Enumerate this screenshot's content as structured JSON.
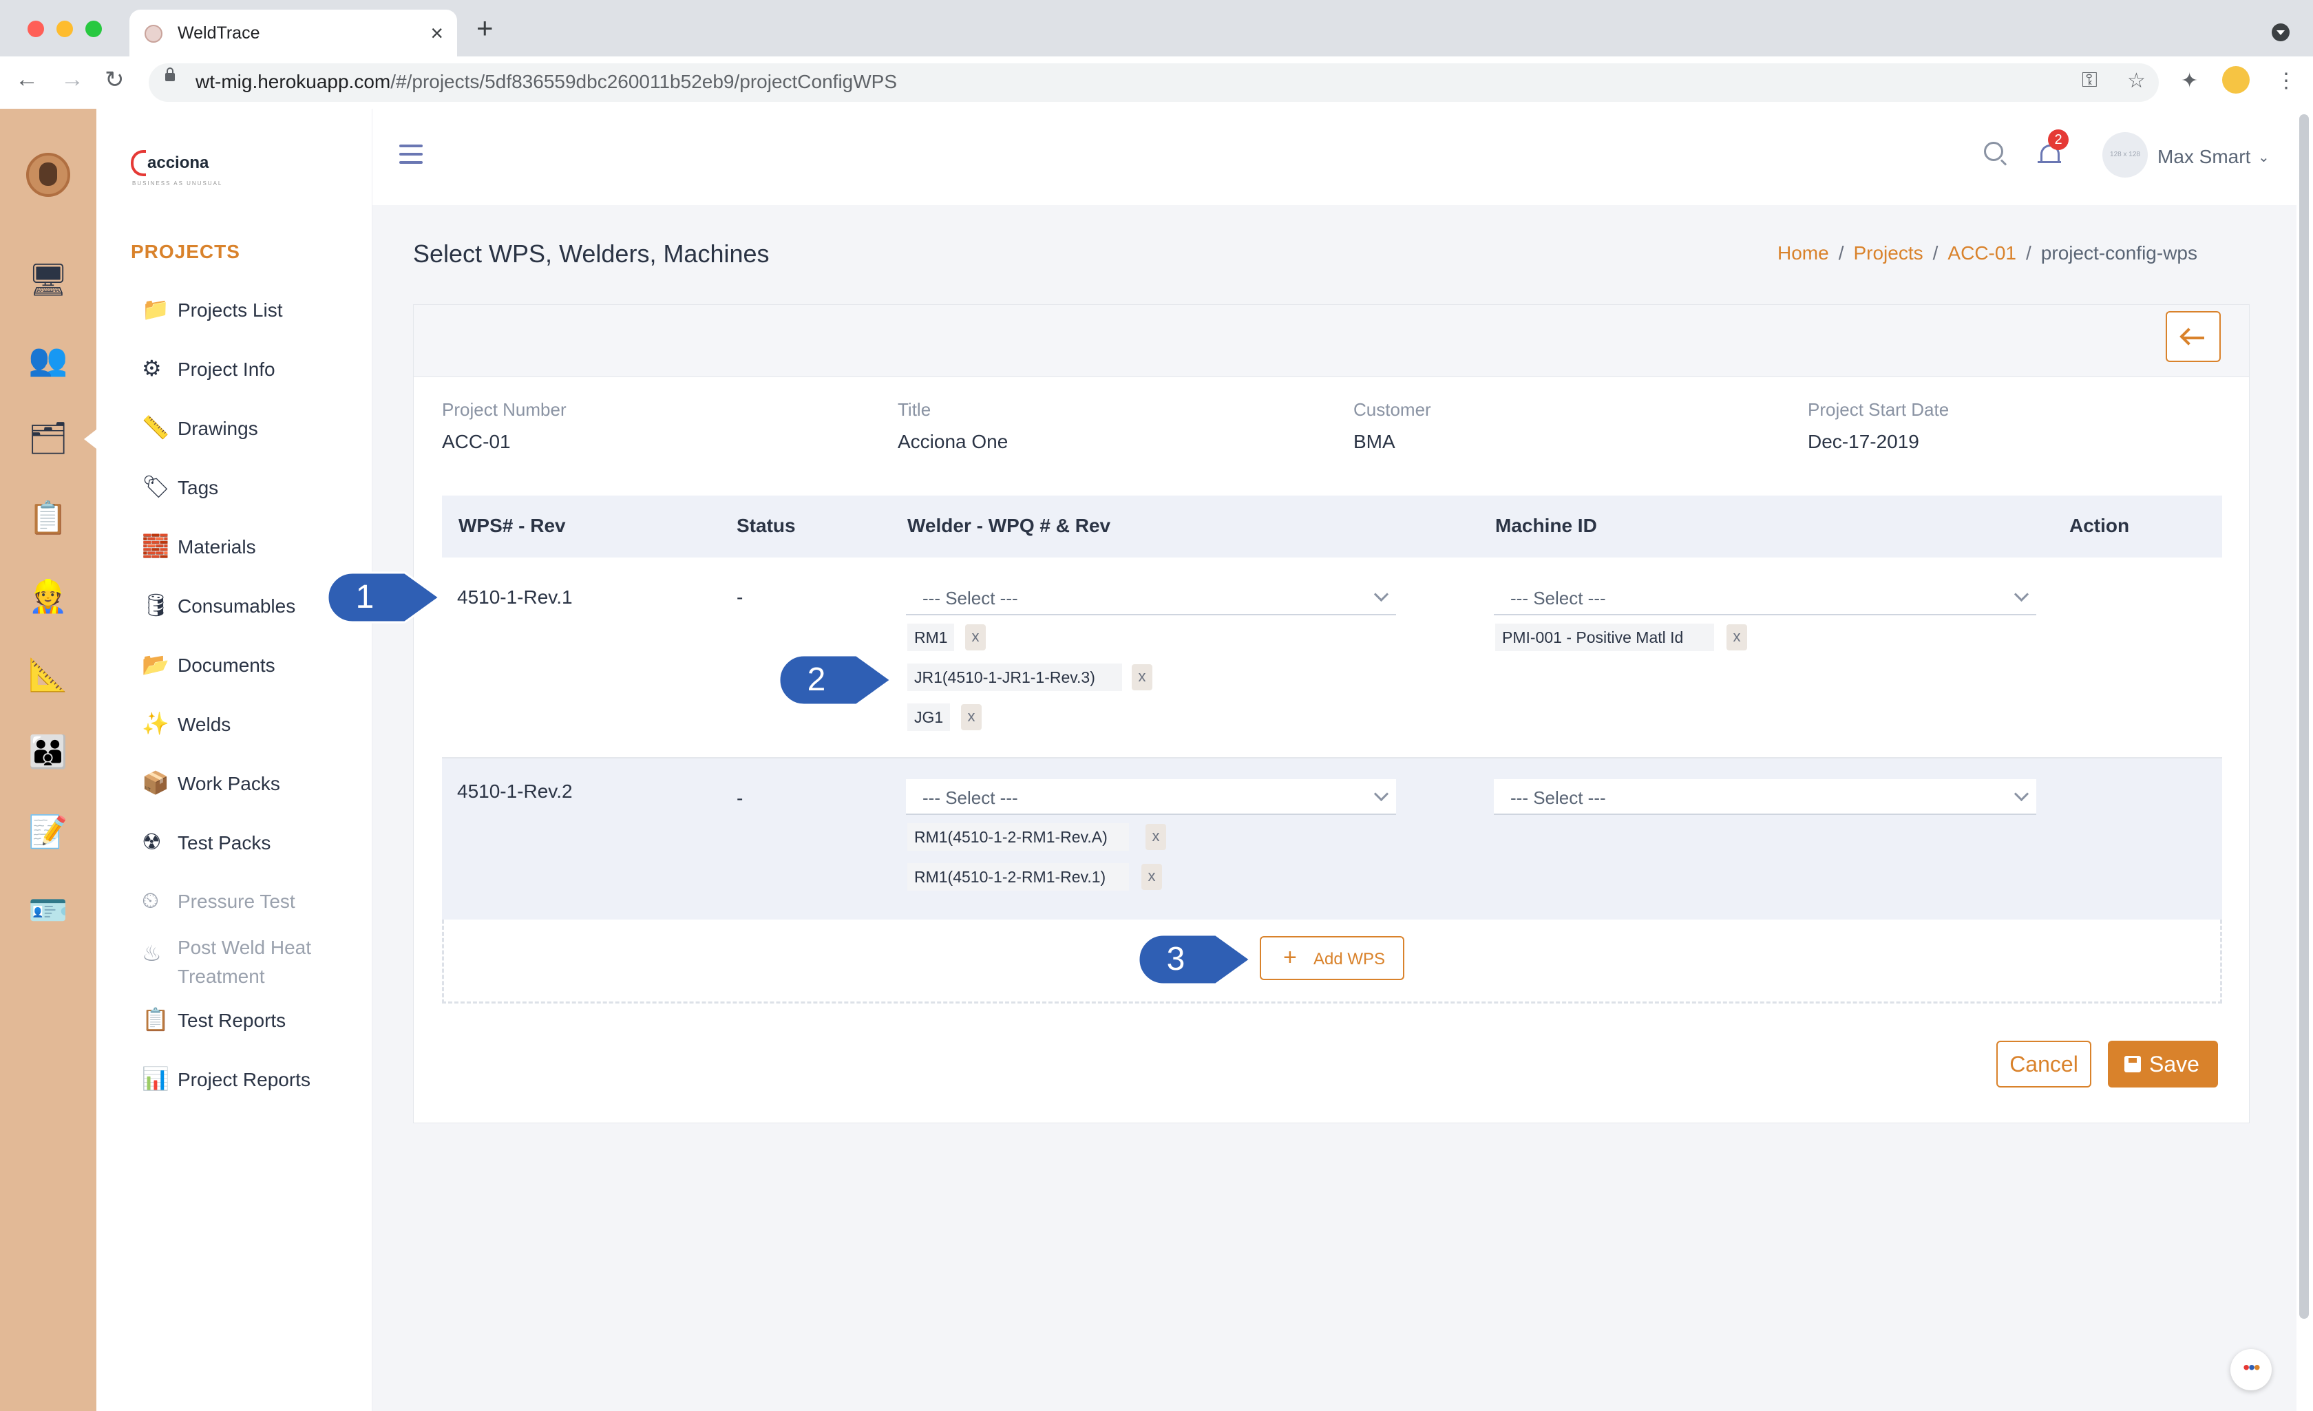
{
  "browser": {
    "tab_title": "WeldTrace",
    "url_host": "wt-mig.herokuapp.com",
    "url_path": "/#/projects/5df836559dbc260011b52eb9/projectConfigWPS"
  },
  "sidebar": {
    "logo_text": "acciona",
    "logo_tagline": "BUSINESS AS UNUSUAL",
    "section_title": "PROJECTS",
    "items": [
      {
        "label": "Projects List",
        "icon": "folder-camera-icon"
      },
      {
        "label": "Project Info",
        "icon": "gears-icon"
      },
      {
        "label": "Drawings",
        "icon": "drafting-tools-icon"
      },
      {
        "label": "Tags",
        "icon": "tag-icon"
      },
      {
        "label": "Materials",
        "icon": "pipes-stack-icon"
      },
      {
        "label": "Consumables",
        "icon": "drum-icon"
      },
      {
        "label": "Documents",
        "icon": "folder-icon"
      },
      {
        "label": "Welds",
        "icon": "weld-sparks-icon"
      },
      {
        "label": "Work Packs",
        "icon": "box-icon"
      },
      {
        "label": "Test Packs",
        "icon": "radiation-icon"
      },
      {
        "label": "Pressure Test",
        "icon": "gauge-icon"
      },
      {
        "label": "Post Weld Heat",
        "icon": "heater-icon"
      },
      {
        "label": "Test Reports",
        "icon": "clipboard-icon"
      },
      {
        "label": "Project Reports",
        "icon": "report-chart-icon"
      }
    ],
    "item_treatment_line2": "Treatment"
  },
  "header": {
    "notification_count": "2",
    "avatar_placeholder": "128 x 128",
    "user_name": "Max Smart"
  },
  "page": {
    "title": "Select WPS, Welders, Machines",
    "breadcrumb": {
      "home": "Home",
      "projects": "Projects",
      "project": "ACC-01",
      "current": "project-config-wps"
    }
  },
  "project_info": {
    "number_label": "Project Number",
    "number": "ACC-01",
    "title_label": "Title",
    "title": "Acciona One",
    "customer_label": "Customer",
    "customer": "BMA",
    "start_label": "Project Start Date",
    "start": "Dec-17-2019"
  },
  "table": {
    "headers": {
      "wps": "WPS# - Rev",
      "status": "Status",
      "welder": "Welder - WPQ # & Rev",
      "machine": "Machine ID",
      "action": "Action"
    },
    "select_placeholder": "--- Select ---",
    "chip_remove": "x",
    "rows": [
      {
        "wps": "4510-1-Rev.1",
        "status": "-",
        "welders": [
          "RM1",
          "JR1(4510-1-JR1-1-Rev.3)",
          "JG1"
        ],
        "machines": [
          "PMI-001 - Positive Matl Id"
        ]
      },
      {
        "wps": "4510-1-Rev.2",
        "status": "-",
        "welders": [
          "RM1(4510-1-2-RM1-Rev.A)",
          "RM1(4510-1-2-RM1-Rev.1)"
        ],
        "machines": []
      }
    ]
  },
  "actions": {
    "add_wps": "Add WPS",
    "cancel": "Cancel",
    "save": "Save"
  },
  "callouts": [
    "1",
    "2",
    "3"
  ],
  "colors": {
    "accent": "#d9822b",
    "rail": "#e2b996",
    "callout": "#2f5fb4"
  }
}
